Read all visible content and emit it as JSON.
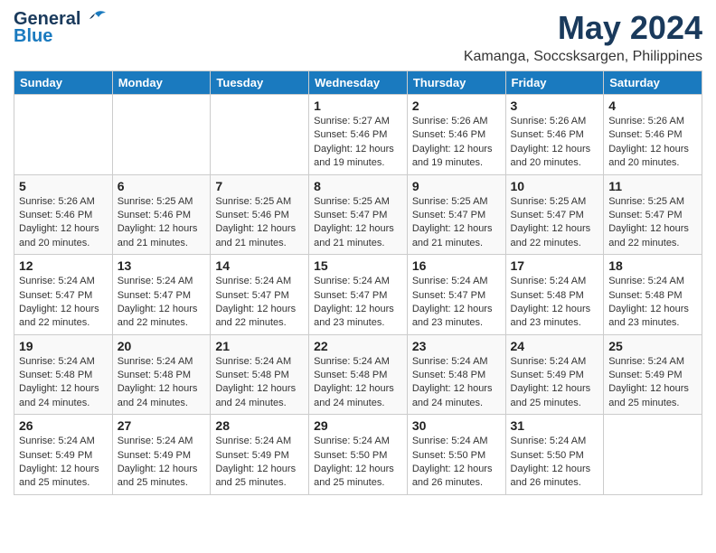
{
  "header": {
    "logo_general": "General",
    "logo_blue": "Blue",
    "month_title": "May 2024",
    "location": "Kamanga, Soccsksargen, Philippines"
  },
  "weekdays": [
    "Sunday",
    "Monday",
    "Tuesday",
    "Wednesday",
    "Thursday",
    "Friday",
    "Saturday"
  ],
  "weeks": [
    [
      {
        "day": "",
        "info": ""
      },
      {
        "day": "",
        "info": ""
      },
      {
        "day": "",
        "info": ""
      },
      {
        "day": "1",
        "info": "Sunrise: 5:27 AM\nSunset: 5:46 PM\nDaylight: 12 hours\nand 19 minutes."
      },
      {
        "day": "2",
        "info": "Sunrise: 5:26 AM\nSunset: 5:46 PM\nDaylight: 12 hours\nand 19 minutes."
      },
      {
        "day": "3",
        "info": "Sunrise: 5:26 AM\nSunset: 5:46 PM\nDaylight: 12 hours\nand 20 minutes."
      },
      {
        "day": "4",
        "info": "Sunrise: 5:26 AM\nSunset: 5:46 PM\nDaylight: 12 hours\nand 20 minutes."
      }
    ],
    [
      {
        "day": "5",
        "info": "Sunrise: 5:26 AM\nSunset: 5:46 PM\nDaylight: 12 hours\nand 20 minutes."
      },
      {
        "day": "6",
        "info": "Sunrise: 5:25 AM\nSunset: 5:46 PM\nDaylight: 12 hours\nand 21 minutes."
      },
      {
        "day": "7",
        "info": "Sunrise: 5:25 AM\nSunset: 5:46 PM\nDaylight: 12 hours\nand 21 minutes."
      },
      {
        "day": "8",
        "info": "Sunrise: 5:25 AM\nSunset: 5:47 PM\nDaylight: 12 hours\nand 21 minutes."
      },
      {
        "day": "9",
        "info": "Sunrise: 5:25 AM\nSunset: 5:47 PM\nDaylight: 12 hours\nand 21 minutes."
      },
      {
        "day": "10",
        "info": "Sunrise: 5:25 AM\nSunset: 5:47 PM\nDaylight: 12 hours\nand 22 minutes."
      },
      {
        "day": "11",
        "info": "Sunrise: 5:25 AM\nSunset: 5:47 PM\nDaylight: 12 hours\nand 22 minutes."
      }
    ],
    [
      {
        "day": "12",
        "info": "Sunrise: 5:24 AM\nSunset: 5:47 PM\nDaylight: 12 hours\nand 22 minutes."
      },
      {
        "day": "13",
        "info": "Sunrise: 5:24 AM\nSunset: 5:47 PM\nDaylight: 12 hours\nand 22 minutes."
      },
      {
        "day": "14",
        "info": "Sunrise: 5:24 AM\nSunset: 5:47 PM\nDaylight: 12 hours\nand 22 minutes."
      },
      {
        "day": "15",
        "info": "Sunrise: 5:24 AM\nSunset: 5:47 PM\nDaylight: 12 hours\nand 23 minutes."
      },
      {
        "day": "16",
        "info": "Sunrise: 5:24 AM\nSunset: 5:47 PM\nDaylight: 12 hours\nand 23 minutes."
      },
      {
        "day": "17",
        "info": "Sunrise: 5:24 AM\nSunset: 5:48 PM\nDaylight: 12 hours\nand 23 minutes."
      },
      {
        "day": "18",
        "info": "Sunrise: 5:24 AM\nSunset: 5:48 PM\nDaylight: 12 hours\nand 23 minutes."
      }
    ],
    [
      {
        "day": "19",
        "info": "Sunrise: 5:24 AM\nSunset: 5:48 PM\nDaylight: 12 hours\nand 24 minutes."
      },
      {
        "day": "20",
        "info": "Sunrise: 5:24 AM\nSunset: 5:48 PM\nDaylight: 12 hours\nand 24 minutes."
      },
      {
        "day": "21",
        "info": "Sunrise: 5:24 AM\nSunset: 5:48 PM\nDaylight: 12 hours\nand 24 minutes."
      },
      {
        "day": "22",
        "info": "Sunrise: 5:24 AM\nSunset: 5:48 PM\nDaylight: 12 hours\nand 24 minutes."
      },
      {
        "day": "23",
        "info": "Sunrise: 5:24 AM\nSunset: 5:48 PM\nDaylight: 12 hours\nand 24 minutes."
      },
      {
        "day": "24",
        "info": "Sunrise: 5:24 AM\nSunset: 5:49 PM\nDaylight: 12 hours\nand 25 minutes."
      },
      {
        "day": "25",
        "info": "Sunrise: 5:24 AM\nSunset: 5:49 PM\nDaylight: 12 hours\nand 25 minutes."
      }
    ],
    [
      {
        "day": "26",
        "info": "Sunrise: 5:24 AM\nSunset: 5:49 PM\nDaylight: 12 hours\nand 25 minutes."
      },
      {
        "day": "27",
        "info": "Sunrise: 5:24 AM\nSunset: 5:49 PM\nDaylight: 12 hours\nand 25 minutes."
      },
      {
        "day": "28",
        "info": "Sunrise: 5:24 AM\nSunset: 5:49 PM\nDaylight: 12 hours\nand 25 minutes."
      },
      {
        "day": "29",
        "info": "Sunrise: 5:24 AM\nSunset: 5:50 PM\nDaylight: 12 hours\nand 25 minutes."
      },
      {
        "day": "30",
        "info": "Sunrise: 5:24 AM\nSunset: 5:50 PM\nDaylight: 12 hours\nand 26 minutes."
      },
      {
        "day": "31",
        "info": "Sunrise: 5:24 AM\nSunset: 5:50 PM\nDaylight: 12 hours\nand 26 minutes."
      },
      {
        "day": "",
        "info": ""
      }
    ]
  ]
}
